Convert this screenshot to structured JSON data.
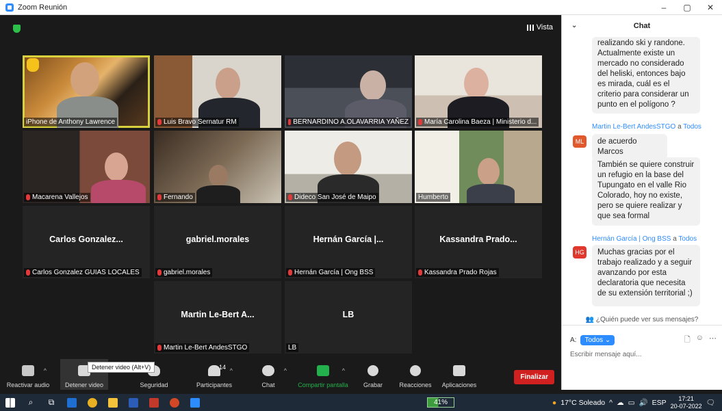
{
  "window": {
    "title": "Zoom Reunión",
    "controls": [
      "–",
      "▢",
      "✕"
    ]
  },
  "meeting": {
    "view_label": "Vista",
    "tiles": [
      {
        "name": "iPhone de Anthony Lawrence",
        "muted": false,
        "video": true
      },
      {
        "name": "Luis Bravo Sernatur RM",
        "muted": true,
        "video": true
      },
      {
        "name": "BERNARDINO A.OLAVARRIA YAÑEZ",
        "muted": true,
        "video": true
      },
      {
        "name": "María Carolina Baeza | Ministerio d...",
        "muted": true,
        "video": true
      },
      {
        "name": "Macarena Vallejos",
        "muted": true,
        "video": true
      },
      {
        "name": "Fernando",
        "muted": true,
        "video": true
      },
      {
        "name": "Dideco San José de Maipo",
        "muted": true,
        "video": true
      },
      {
        "name": "Humberto",
        "muted": false,
        "video": true
      },
      {
        "name": "Carlos Gonzalez GUIAS LOCALES",
        "display": "Carlos Gonzalez...",
        "muted": true,
        "video": false
      },
      {
        "name": "gabriel.morales",
        "display": "gabriel.morales",
        "muted": true,
        "video": false
      },
      {
        "name": "Hernán García | Ong BSS",
        "display": "Hernán García |...",
        "muted": true,
        "video": false
      },
      {
        "name": "Kassandra Prado Rojas",
        "display": "Kassandra Prado...",
        "muted": true,
        "video": false
      },
      {
        "name": "Martin Le-Bert AndesSTGO",
        "display": "Martin Le-Bert A...",
        "muted": true,
        "video": false
      },
      {
        "name": "LB",
        "display": "LB",
        "muted": false,
        "video": false
      }
    ]
  },
  "toolbar": {
    "audio": "Reactivar audio",
    "video": "Detener video",
    "security": "Seguridad",
    "participants": "Participantes",
    "participants_count": "14",
    "chat": "Chat",
    "share": "Compartir pantalla",
    "record": "Grabar",
    "reactions": "Reacciones",
    "apps": "Aplicaciones",
    "end": "Finalizar",
    "tooltip": "Detener video (Alt+V)"
  },
  "chat": {
    "title": "Chat",
    "messages": [
      {
        "text": "realizando ski y randone. Actualmente existe un mercado no considerado del heliski, entonces bajo es mirada, cuál es el criterio para considerar un punto en el polígono ?"
      },
      {
        "sender": "Martin Le-Bert AndesSTGO",
        "to_word": "a",
        "to": "Todos",
        "avatar": "ML",
        "avatar_color": "#e0582c",
        "text": "de acuerdo Marcos"
      },
      {
        "text": "También se quiere construir un refugio en la base del Tupungato en el valle Rio Colorado, hoy no existe, pero se quiere realizar y que sea formal"
      },
      {
        "sender": "Hernán García | Ong BSS",
        "to_word": "a",
        "to": "Todos",
        "avatar": "HG",
        "avatar_color": "#e0382c",
        "text": "Muchas gracias por el trabajo realizado y a seguir avanzando por esta declaratoria que necesita de su extensión territorial ;)"
      }
    ],
    "who_can_see": "¿Quién puede ver sus mensajes?",
    "to_label": "A:",
    "to_value": "Todos ⌄",
    "placeholder": "Escribir mensaje aquí..."
  },
  "taskbar": {
    "battery": "41%",
    "weather": "17°C Soleado",
    "lang": "ESP",
    "time": "17:21",
    "date": "20-07-2022"
  }
}
